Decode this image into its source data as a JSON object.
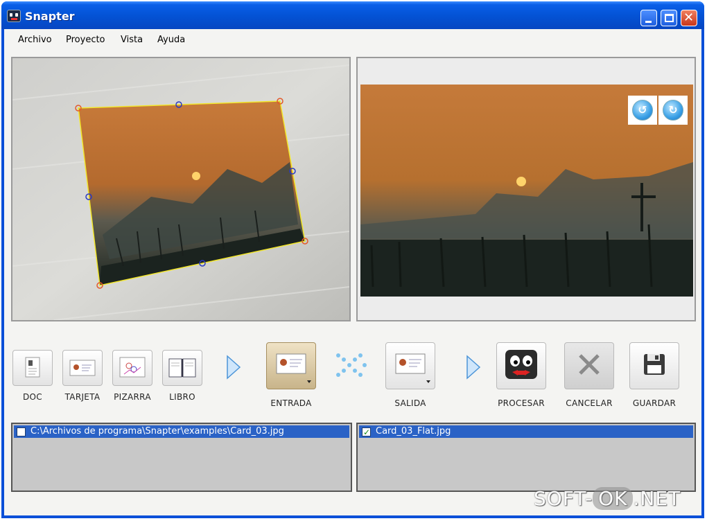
{
  "window": {
    "title": "Snapter"
  },
  "menu": [
    "Archivo",
    "Proyecto",
    "Vista",
    "Ayuda"
  ],
  "toolbar": {
    "modes": [
      {
        "label": "DOC",
        "icon": "document-icon"
      },
      {
        "label": "TARJETA",
        "icon": "card-icon"
      },
      {
        "label": "PIZARRA",
        "icon": "whiteboard-icon"
      },
      {
        "label": "LIBRO",
        "icon": "book-icon"
      }
    ],
    "entrada": "ENTRADA",
    "salida": "SALIDA",
    "procesar": "PROCESAR",
    "cancelar": "CANCELAR",
    "guardar": "GUARDAR"
  },
  "input_list": {
    "items": [
      {
        "path": "C:\\Archivos de programa\\Snapter\\examples\\Card_03.jpg",
        "checked": false
      }
    ]
  },
  "output_list": {
    "items": [
      {
        "path": "Card_03_Flat.jpg",
        "checked": true
      }
    ]
  },
  "watermark": {
    "left": "SOFT-",
    "mid": "OK",
    "right": ".NET"
  },
  "colors": {
    "title_bar": "#0a4fd8",
    "selection": "#2a62c6",
    "crop_border": "#f2e62a"
  }
}
